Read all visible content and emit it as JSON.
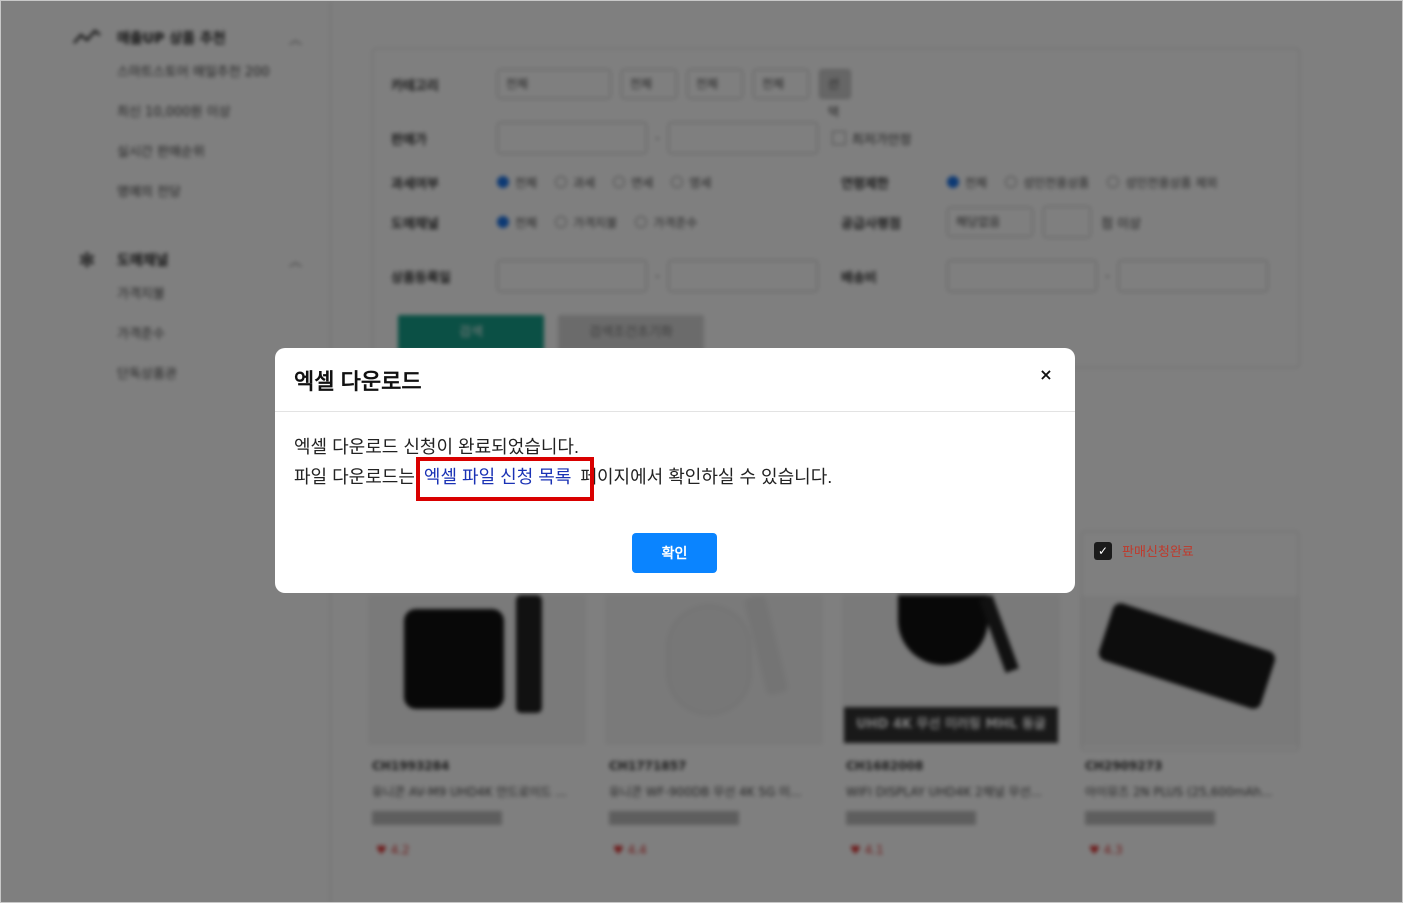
{
  "sidebar": {
    "groups": [
      {
        "icon": "trend-up-icon",
        "label": "매출UP 상품 추천",
        "items": [
          "스마트스토어 매일추천 200",
          "최신 10,000원 이상",
          "실시간 판매순위",
          "명예의 전당"
        ]
      },
      {
        "icon": "asterisk-icon",
        "label": "도매채널",
        "items": [
          "가격지불",
          "가격준수",
          "단독상품관"
        ]
      }
    ]
  },
  "filter": {
    "category_label": "카테고리",
    "category_selects": [
      "전체",
      "전체",
      "전체",
      "전체"
    ],
    "category_button": "선택",
    "price_label": "판매가",
    "price_check": "최저가안정",
    "tax_label": "과세여부",
    "tax_options": [
      "전체",
      "과세",
      "면세",
      "영세"
    ],
    "adult_label": "연령제한",
    "adult_options": [
      "전체",
      "성인전용상품",
      "성인전용상품 제외"
    ],
    "wholesale_label": "도매채널",
    "wholesale_options": [
      "전체",
      "가격지불",
      "가격준수"
    ],
    "supply_label": "공급사평점",
    "supply_select": "해당없음",
    "supply_suffix": "점 이상",
    "regdate_label": "상품등록일",
    "shipping_label": "배송비",
    "search_button": "검색",
    "reset_button": "검색조건초기화"
  },
  "products": [
    {
      "code": "CH1993284",
      "name": "유니콘 AV-M9 UHD4K 안드로이드 ...",
      "heart": "♥ 4.2"
    },
    {
      "code": "CH1771857",
      "name": "유니콘 WF-900DB 무선 4K 5G 미...",
      "heart": "♥ 4.4"
    },
    {
      "code": "CH1682008",
      "name": "WIFI DISPLAY UHD4K 2채널 무선...",
      "heart": "♥ 4.1",
      "overlay_text": "UHD 4K 무선 미러링 MHL 동글"
    },
    {
      "code": "CH2909273",
      "name": "아이뮤즈 2N PLUS (25,600mAh...",
      "heart": "♥ 4.3"
    }
  ],
  "badge": {
    "label": "판매신청완료"
  },
  "modal": {
    "title": "엑셀 다운로드",
    "line1": "엑셀 다운로드 신청이 완료되었습니다.",
    "line2_before": "파일 다운로드는 ",
    "link": "엑셀 파일 신청 목록",
    "line2_after": " 페이지에서 확인하실 수 있습니다.",
    "ok_button": "확인",
    "close_symbol": "×"
  },
  "colors": {
    "accent": "#0a84ff",
    "link": "#1a32b5",
    "highlight": "#d90000",
    "search": "#17a08a"
  }
}
